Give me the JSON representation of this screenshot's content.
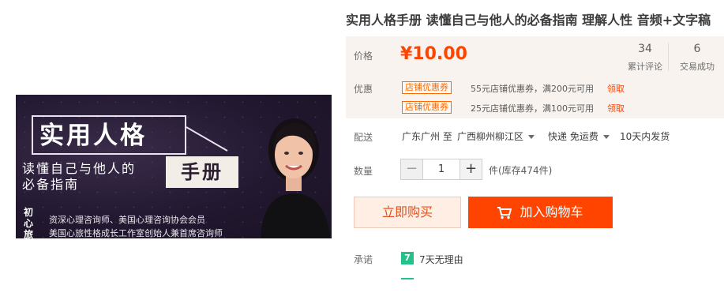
{
  "product": {
    "title": "实用人格手册 读懂自己与他人的必备指南 理解人性 音频+文字稿"
  },
  "banner": {
    "main_title": "实用人格",
    "sub_line1": "读懂自己与他人的",
    "sub_line2": "必备指南",
    "badge": "手册",
    "side_tag": "初心旅",
    "credential1": "资深心理咨询师、美国心理咨询协会会员",
    "credential2": "美国心旅性格成长工作室创始人兼首席咨询师"
  },
  "price": {
    "label": "价格",
    "value": "¥10.00",
    "reviews_count": "34",
    "reviews_label": "累计评论",
    "sales_count": "6",
    "sales_label": "交易成功"
  },
  "promo": {
    "label": "优惠",
    "coupons": [
      {
        "tag": "店铺优惠券",
        "text": "55元店铺优惠券，满200元可用",
        "link": "领取"
      },
      {
        "tag": "店铺优惠券",
        "text": "25元店铺优惠券，满100元可用",
        "link": "领取"
      }
    ]
  },
  "delivery": {
    "label": "配送",
    "from": "广东广州 至",
    "to": "广西柳州柳江区",
    "method": "快递 免运费",
    "eta": "10天内发货"
  },
  "quantity": {
    "label": "数量",
    "minus": "−",
    "value": "1",
    "plus": "+",
    "stock": "件(库存474件)"
  },
  "actions": {
    "buy_now": "立即购买",
    "add_to_cart": "加入购物车"
  },
  "promise": {
    "label": "承诺",
    "icon_text": "7",
    "text": "7天无理由"
  },
  "colors": {
    "accent": "#ff4400",
    "promise_green": "#25c18b",
    "panel_bg": "#f8f3ef"
  }
}
